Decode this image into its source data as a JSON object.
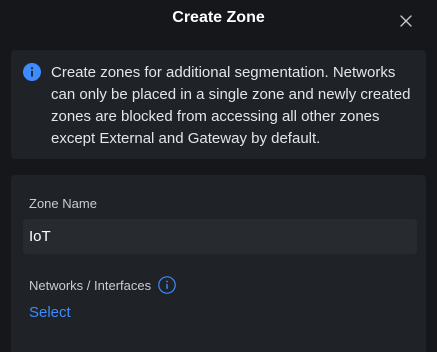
{
  "dialog": {
    "title": "Create Zone",
    "close_icon": "close-icon"
  },
  "info_banner": {
    "icon": "info-icon",
    "text": "Create zones for additional segmentation. Networks can only be placed in a single zone and newly created zones are blocked from accessing all other zones except External and Gateway by default."
  },
  "form": {
    "zone_name": {
      "label": "Zone Name",
      "value": "IoT"
    },
    "networks": {
      "label": "Networks / Interfaces",
      "info_icon": "info-outline-icon",
      "select_label": "Select"
    }
  },
  "colors": {
    "background": "#15171a",
    "card": "#1f2226",
    "input": "#272a2f",
    "accent": "#3d8bff",
    "info_icon_fill": "#3d8bff"
  }
}
